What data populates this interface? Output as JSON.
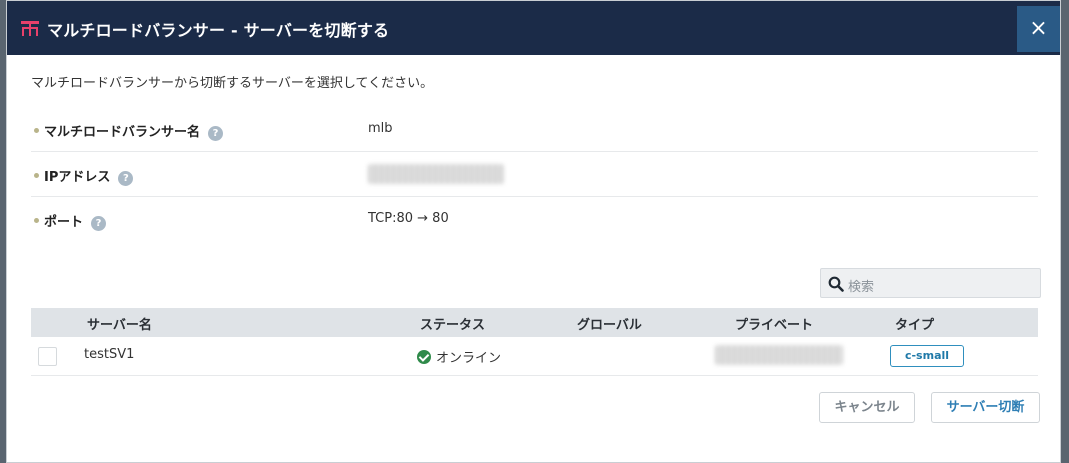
{
  "dialog": {
    "title": "マルチロードバランサー - サーバーを切断する",
    "close_glyph": "×",
    "description": "マルチロードバランサーから切断するサーバーを選択してください。"
  },
  "info": {
    "name_label": "マルチロードバランサー名",
    "name_value": "mlb",
    "ip_label": "IPアドレス",
    "port_label": "ポート",
    "port_value": "TCP:80 → 80",
    "help_glyph": "?"
  },
  "search": {
    "placeholder": "検索"
  },
  "table": {
    "columns": [
      "サーバー名",
      "ステータス",
      "グローバル",
      "プライベート",
      "タイプ"
    ],
    "rows": [
      {
        "server_name": "testSV1",
        "status": "オンライン",
        "type": "c-small"
      }
    ]
  },
  "buttons": {
    "cancel": "キャンセル",
    "disconnect": "サーバー切断"
  },
  "colors": {
    "titlebar": "#1b2b48",
    "close_button": "#2a5a86",
    "status_ok": "#2f8a4a",
    "type_badge": "#2f8fbe",
    "brand_icon": "#e8406b"
  }
}
